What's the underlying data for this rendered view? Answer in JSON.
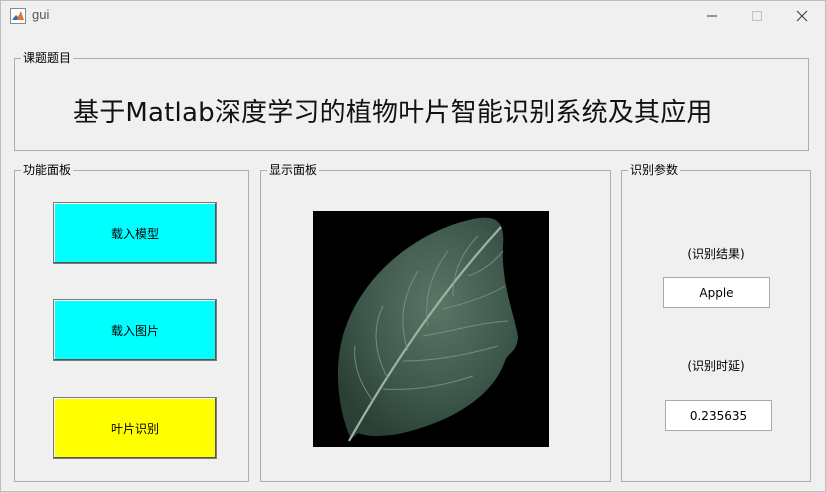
{
  "window": {
    "title": "gui",
    "icons": {
      "app": "matlab-icon",
      "minimize": "minimize-icon",
      "maximize": "maximize-icon",
      "close": "close-icon"
    }
  },
  "topic_panel": {
    "title": "课题题目",
    "heading": "基于Matlab深度学习的植物叶片智能识别系统及其应用"
  },
  "function_panel": {
    "title": "功能面板",
    "buttons": [
      {
        "label": "载入模型",
        "color": "#00ffff"
      },
      {
        "label": "载入图片",
        "color": "#00ffff"
      },
      {
        "label": "叶片识别",
        "color": "#ffff00"
      }
    ]
  },
  "display_panel": {
    "title": "显示面板",
    "image": {
      "subject": "leaf-image",
      "background": "#000000",
      "leaf_color": "#3f5a4d"
    }
  },
  "params_panel": {
    "title": "识别参数",
    "result_label": "(识别结果)",
    "result_value": "Apple",
    "time_label": "(识别时延)",
    "time_value": "0.235635"
  }
}
